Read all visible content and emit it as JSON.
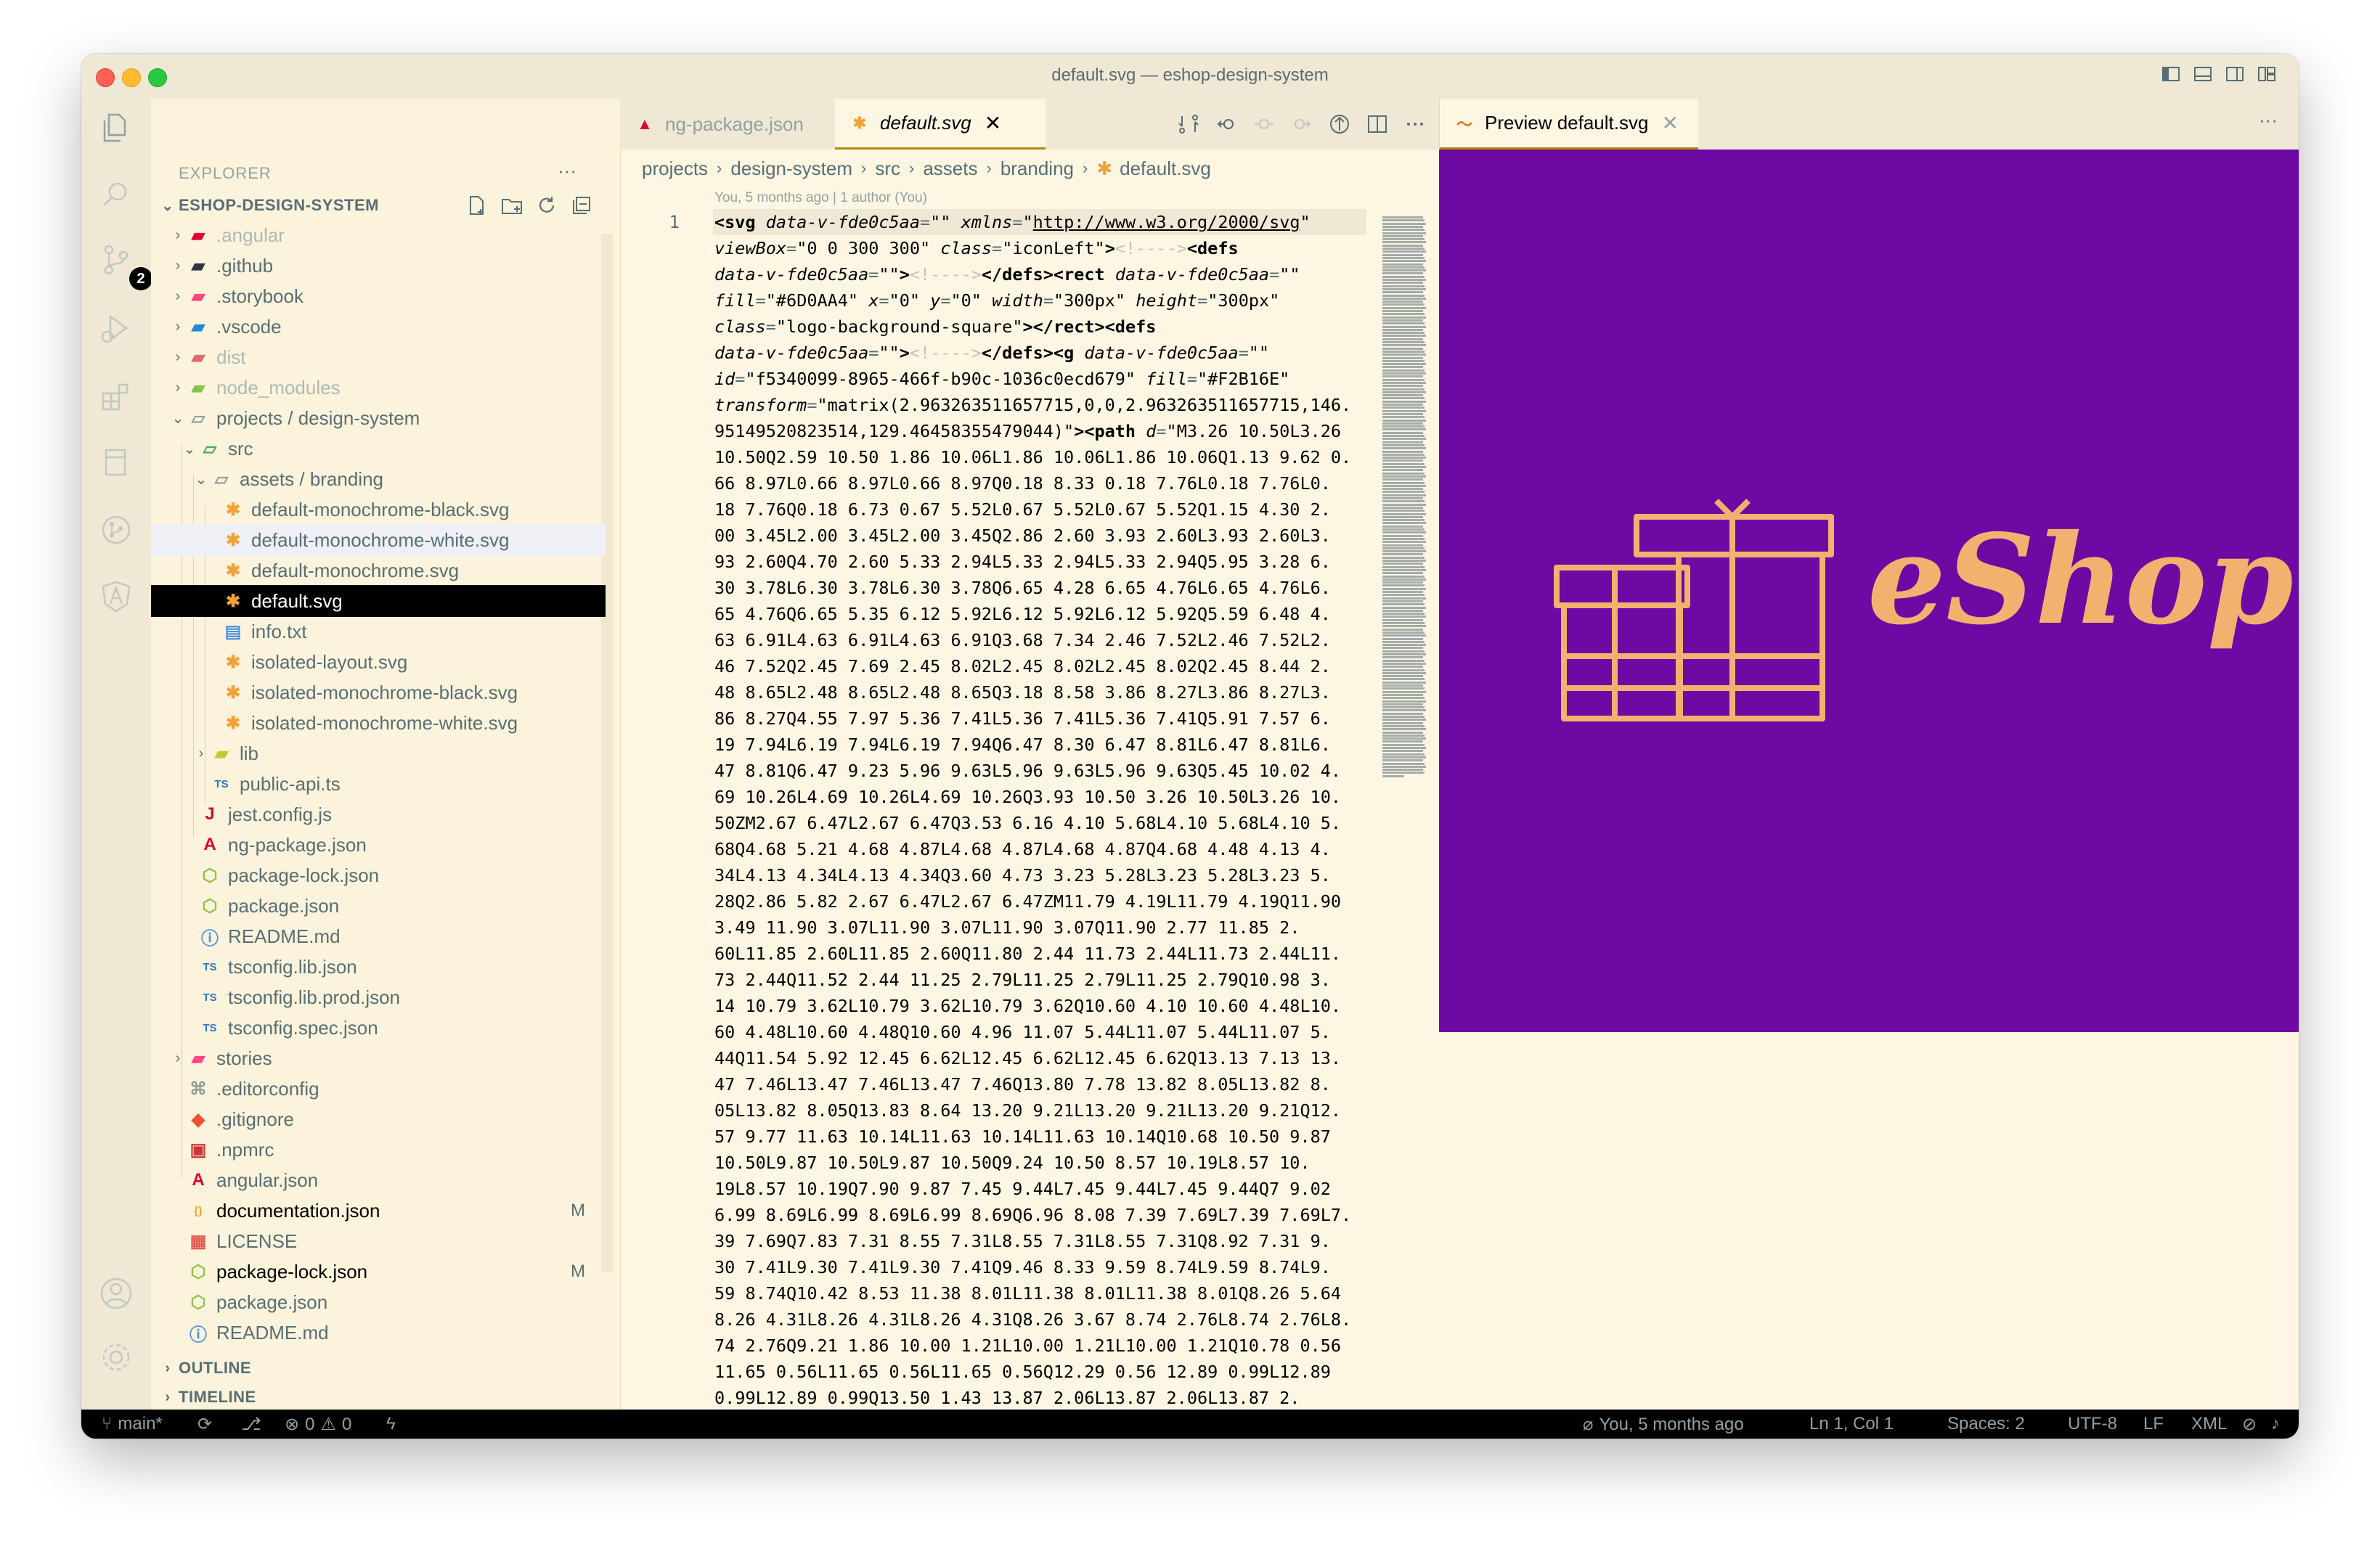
{
  "window": {
    "title": "default.svg — eshop-design-system"
  },
  "activity_bar": {
    "items": [
      "explorer-icon",
      "search-icon",
      "source-control-icon",
      "run-debug-icon",
      "extensions-icon",
      "remote-explorer-icon",
      "git-graph-icon",
      "angular-icon"
    ],
    "scm_badge": "2",
    "bottom": [
      "account-icon",
      "settings-gear-icon"
    ]
  },
  "sidebar": {
    "title": "EXPLORER",
    "more": "···",
    "root_label": "ESHOP-DESIGN-SYSTEM",
    "tree": [
      {
        "label": ".angular",
        "icon": "angular-folder",
        "dim": true
      },
      {
        "label": ".github",
        "icon": "github-folder"
      },
      {
        "label": ".storybook",
        "icon": "storybook-folder"
      },
      {
        "label": ".vscode",
        "icon": "vscode-folder"
      },
      {
        "label": "dist",
        "icon": "dist-folder",
        "dim": true
      },
      {
        "label": "node_modules",
        "icon": "node-folder",
        "dim": true
      },
      {
        "label": "projects / design-system",
        "icon": "folder-open"
      },
      {
        "label": "src",
        "icon": "src-folder-open"
      },
      {
        "label": "assets / branding",
        "icon": "folder-open"
      },
      {
        "label": "default-monochrome-black.svg",
        "icon": "svg-file"
      },
      {
        "label": "default-monochrome-white.svg",
        "icon": "svg-file"
      },
      {
        "label": "default-monochrome.svg",
        "icon": "svg-file"
      },
      {
        "label": "default.svg",
        "icon": "svg-file"
      },
      {
        "label": "info.txt",
        "icon": "text-file"
      },
      {
        "label": "isolated-layout.svg",
        "icon": "svg-file"
      },
      {
        "label": "isolated-monochrome-black.svg",
        "icon": "svg-file"
      },
      {
        "label": "isolated-monochrome-white.svg",
        "icon": "svg-file"
      },
      {
        "label": "lib",
        "icon": "lib-folder"
      },
      {
        "label": "public-api.ts",
        "icon": "ts-file"
      },
      {
        "label": "jest.config.js",
        "icon": "jest-file"
      },
      {
        "label": "ng-package.json",
        "icon": "angular-file"
      },
      {
        "label": "package-lock.json",
        "icon": "npm-file"
      },
      {
        "label": "package.json",
        "icon": "npm-file"
      },
      {
        "label": "README.md",
        "icon": "info-file"
      },
      {
        "label": "tsconfig.lib.json",
        "icon": "tsconfig-file"
      },
      {
        "label": "tsconfig.lib.prod.json",
        "icon": "tsconfig-file"
      },
      {
        "label": "tsconfig.spec.json",
        "icon": "tsconfig-file"
      },
      {
        "label": "stories",
        "icon": "stories-folder"
      },
      {
        "label": ".editorconfig",
        "icon": "editorconfig-file"
      },
      {
        "label": ".gitignore",
        "icon": "git-file"
      },
      {
        "label": ".npmrc",
        "icon": "npmrc-file"
      },
      {
        "label": "angular.json",
        "icon": "angular-file"
      },
      {
        "label": "documentation.json",
        "icon": "json-file",
        "mark": "M"
      },
      {
        "label": "LICENSE",
        "icon": "license-file"
      },
      {
        "label": "package-lock.json",
        "icon": "npm-file",
        "mark": "M"
      },
      {
        "label": "package.json",
        "icon": "npm-file"
      },
      {
        "label": "README.md",
        "icon": "info-file"
      }
    ],
    "outline": "OUTLINE",
    "timeline": "TIMELINE"
  },
  "editor": {
    "tabs": [
      {
        "label": "ng-package.json",
        "icon": "angular-file"
      },
      {
        "label": "default.svg",
        "icon": "svg-file",
        "close": "✕"
      }
    ],
    "breadcrumb": [
      "projects",
      "design-system",
      "src",
      "assets",
      "branding",
      "default.svg"
    ],
    "blame": "You, 5 months ago | 1 author (You)",
    "line_number": "1"
  },
  "preview": {
    "tab_label": "Preview default.svg",
    "tab_close": "✕",
    "more": "···",
    "logo_text": "eShop",
    "background_color": "#6D0AA4",
    "logo_color": "#F2B16E"
  },
  "statusbar": {
    "branch": "main*",
    "errors": "0",
    "warnings": "0",
    "blame": "You, 5 months ago",
    "position": "Ln 1, Col 1",
    "spaces": "Spaces: 2",
    "encoding": "UTF-8",
    "eol": "LF",
    "language": "XML"
  }
}
